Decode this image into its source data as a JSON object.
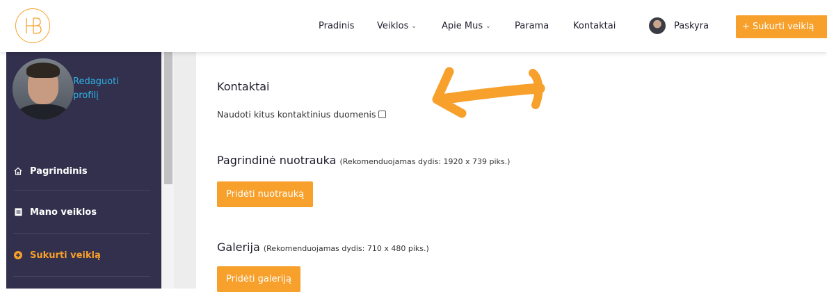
{
  "colors": {
    "accent": "#f7a02b",
    "sidebar": "#32304d",
    "link": "#2db3e6"
  },
  "nav": {
    "items": [
      {
        "label": "Pradinis",
        "dropdown": false
      },
      {
        "label": "Veiklos",
        "dropdown": true
      },
      {
        "label": "Apie Mus",
        "dropdown": true
      },
      {
        "label": "Parama",
        "dropdown": false
      },
      {
        "label": "Kontaktai",
        "dropdown": false
      }
    ],
    "account_label": "Paskyra",
    "create_label": "+ Sukurti veiklą",
    "chevron": "⌄"
  },
  "sidebar": {
    "edit_profile": "Redaguoti profilį",
    "items": [
      {
        "label": "Pagrindinis",
        "icon": "home-icon"
      },
      {
        "label": "Mano veiklos",
        "icon": "document-icon"
      },
      {
        "label": "Sukurti veiklą",
        "icon": "plus-circle-icon"
      }
    ]
  },
  "main": {
    "contacts_heading": "Kontaktai",
    "contacts_checkbox_label": "Naudoti kitus kontaktinius duomenis",
    "photo_heading": "Pagrindinė nuotrauka",
    "photo_note": "(Rekomenduojamas dydis: 1920 x 739 piks.)",
    "photo_button": "Pridėti nuotrauką",
    "gallery_heading": "Galerija",
    "gallery_note": "(Rekomenduojamas dydis: 710 x 480 piks.)",
    "gallery_button": "Pridėti galeriją"
  }
}
